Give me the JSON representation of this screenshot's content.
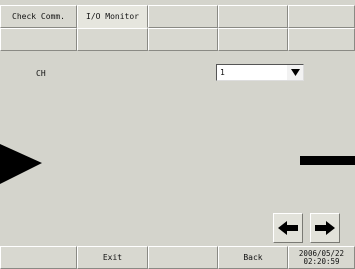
{
  "tabs": [
    {
      "label": "Check Comm."
    },
    {
      "label": "I/O Monitor"
    }
  ],
  "channel": {
    "label": "CH",
    "value": "1"
  },
  "footer": {
    "exit_label": "Exit",
    "back_label": "Back",
    "date": "2006/05/22",
    "time": "02:20:59"
  },
  "icons": {
    "dropdown": "triangle-down-icon",
    "prev": "arrow-left-icon",
    "next": "arrow-right-icon"
  },
  "colors": {
    "background": "#d4d4cc",
    "button": "#d8d8d0",
    "indicator": "#000000"
  }
}
